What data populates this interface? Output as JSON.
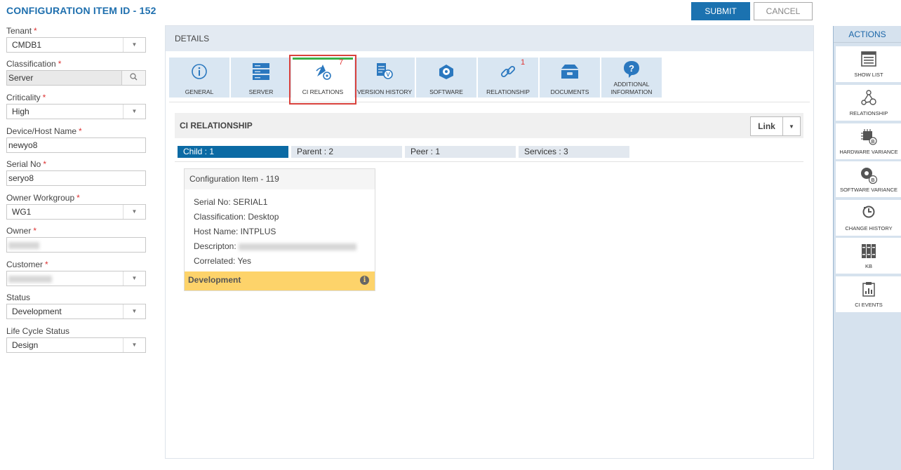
{
  "header": {
    "title": "CONFIGURATION ITEM ID - 152",
    "submit_label": "SUBMIT",
    "cancel_label": "CANCEL"
  },
  "form": {
    "tenant": {
      "label": "Tenant",
      "value": "CMDB1"
    },
    "classification": {
      "label": "Classification",
      "value": "Server"
    },
    "criticality": {
      "label": "Criticality",
      "value": "High"
    },
    "device_host_name": {
      "label": "Device/Host Name",
      "value": "newyo8"
    },
    "serial_no": {
      "label": "Serial No",
      "value": "seryo8"
    },
    "owner_workgroup": {
      "label": "Owner Workgroup",
      "value": "WG1"
    },
    "owner": {
      "label": "Owner"
    },
    "customer": {
      "label": "Customer"
    },
    "status": {
      "label": "Status",
      "value": "Development"
    },
    "life_cycle_status": {
      "label": "Life Cycle Status",
      "value": "Design"
    }
  },
  "details": {
    "title": "DETAILS",
    "tabs": [
      {
        "label": "GENERAL",
        "icon": "info-icon"
      },
      {
        "label": "SERVER",
        "icon": "server-icon"
      },
      {
        "label": "CI RELATIONS",
        "icon": "ci-relations-icon",
        "count": "7",
        "active": true
      },
      {
        "label": "VERSION HISTORY",
        "icon": "version-history-icon"
      },
      {
        "label": "SOFTWARE",
        "icon": "software-icon"
      },
      {
        "label": "RELATIONSHIP",
        "icon": "link-icon",
        "count": "1"
      },
      {
        "label": "DOCUMENTS",
        "icon": "documents-icon"
      },
      {
        "label": "ADDITIONAL INFORMATION",
        "icon": "question-icon"
      }
    ],
    "relationship": {
      "title": "CI RELATIONSHIP",
      "link_label": "Link",
      "subtabs": [
        {
          "label": "Child : 1",
          "active": true
        },
        {
          "label": "Parent : 2"
        },
        {
          "label": "Peer : 1"
        },
        {
          "label": "Services : 3"
        }
      ],
      "card": {
        "title": "Configuration Item - 119",
        "serial": "Serial No: SERIAL1",
        "classification": "Classification: Desktop",
        "host": "Host Name: INTPLUS",
        "description_label": "Descripton:",
        "correlated": "Correlated: Yes",
        "status": "Development"
      }
    }
  },
  "actions": {
    "title": "ACTIONS",
    "items": [
      {
        "label": "SHOW LIST",
        "icon": "list-icon"
      },
      {
        "label": "RELATIONSHIP",
        "icon": "relationship-icon"
      },
      {
        "label": "HARDWARE VARIANCE",
        "icon": "hardware-variance-icon"
      },
      {
        "label": "SOFTWARE VARIANCE",
        "icon": "software-variance-icon"
      },
      {
        "label": "CHANGE HISTORY",
        "icon": "change-history-icon"
      },
      {
        "label": "KB",
        "icon": "kb-icon"
      },
      {
        "label": "CI EVENTS",
        "icon": "ci-events-icon"
      }
    ]
  },
  "colors": {
    "accent": "#1b72b0",
    "active_tab_bar": "#3ab04a",
    "highlight_box": "#d9413c",
    "status_band": "#fdd36a"
  }
}
